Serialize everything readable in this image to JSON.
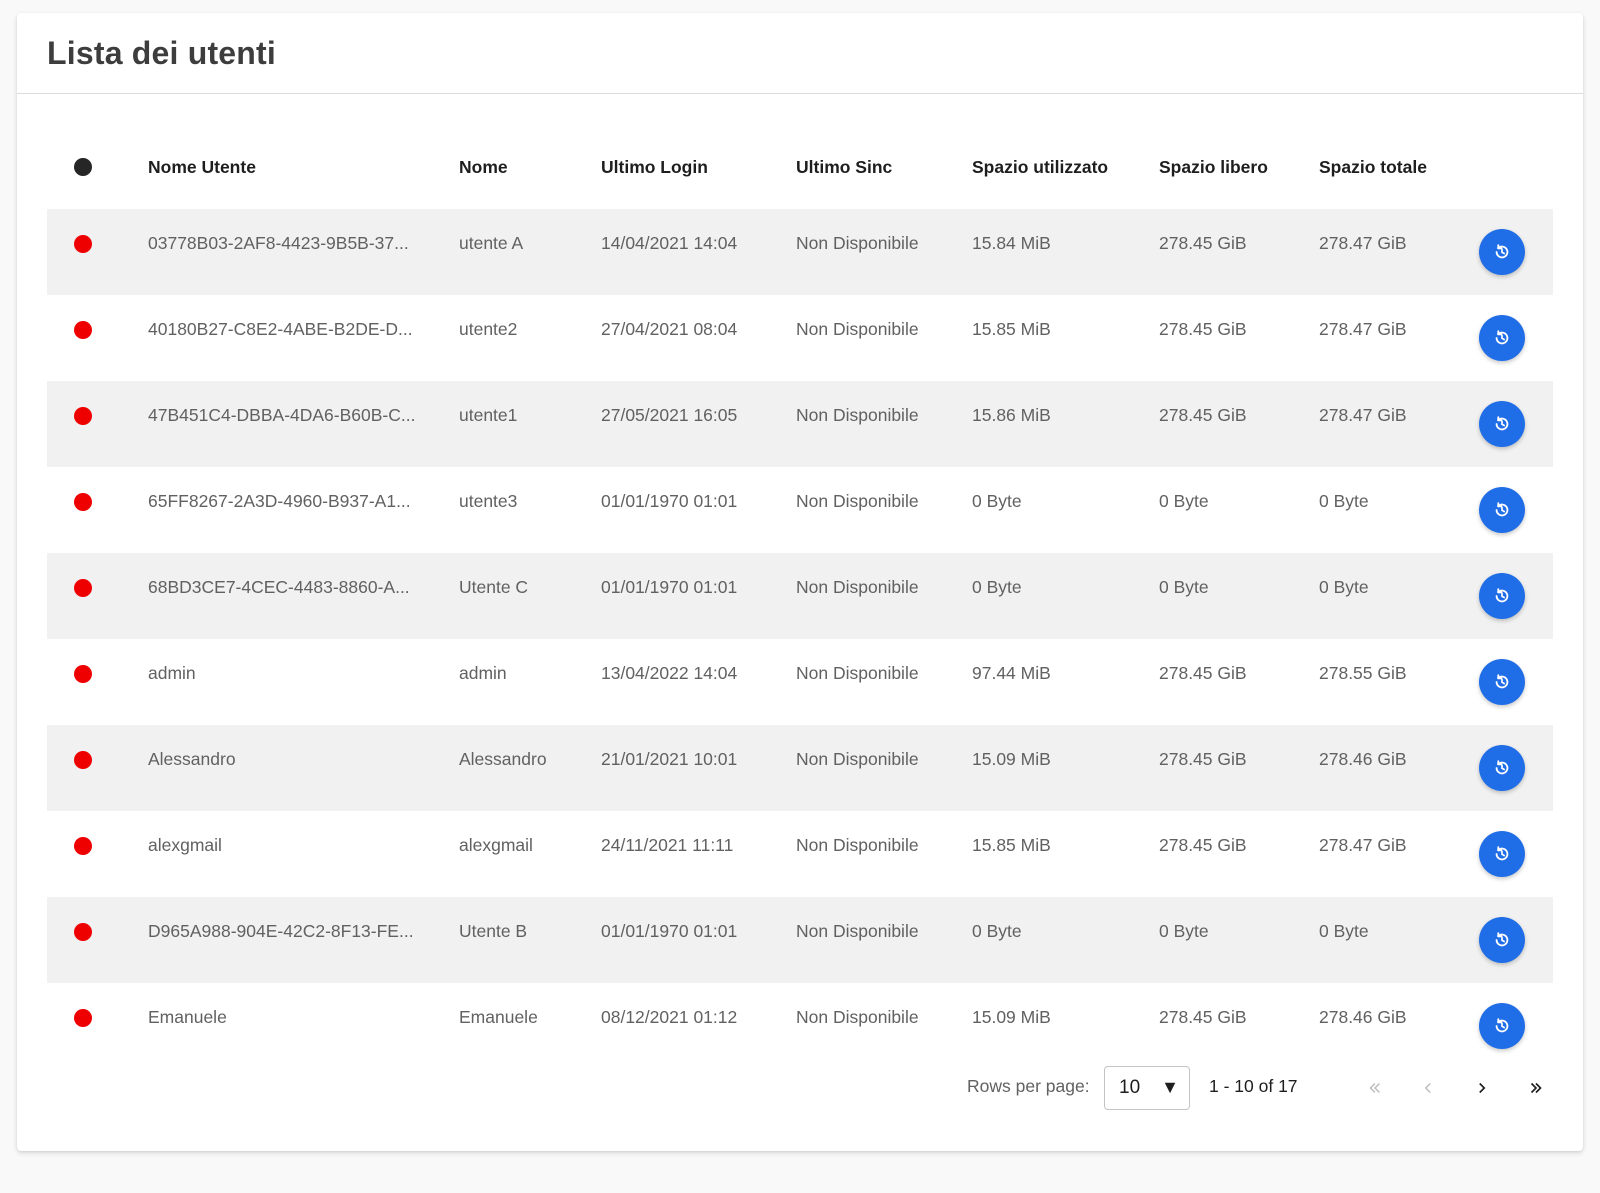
{
  "title": "Lista dei utenti",
  "colors": {
    "accent": "#1f6ee8",
    "status_offline": "#ee0000",
    "status_header": "#262626",
    "row_alt": "#f1f1f1"
  },
  "columns": [
    "Nome Utente",
    "Nome",
    "Ultimo Login",
    "Ultimo Sinc",
    "Spazio utilizzato",
    "Spazio libero",
    "Spazio totale"
  ],
  "rows": [
    {
      "user": "03778B03-2AF8-4423-9B5B-37...",
      "name": "utente A",
      "login": "14/04/2021 14:04",
      "sync": "Non Disponibile",
      "used": "15.84 MiB",
      "free": "278.45 GiB",
      "total": "278.47 GiB"
    },
    {
      "user": "40180B27-C8E2-4ABE-B2DE-D...",
      "name": "utente2",
      "login": "27/04/2021 08:04",
      "sync": "Non Disponibile",
      "used": "15.85 MiB",
      "free": "278.45 GiB",
      "total": "278.47 GiB"
    },
    {
      "user": "47B451C4-DBBA-4DA6-B60B-C...",
      "name": "utente1",
      "login": "27/05/2021 16:05",
      "sync": "Non Disponibile",
      "used": "15.86 MiB",
      "free": "278.45 GiB",
      "total": "278.47 GiB"
    },
    {
      "user": "65FF8267-2A3D-4960-B937-A1...",
      "name": "utente3",
      "login": "01/01/1970 01:01",
      "sync": "Non Disponibile",
      "used": "0 Byte",
      "free": "0 Byte",
      "total": "0 Byte"
    },
    {
      "user": "68BD3CE7-4CEC-4483-8860-A...",
      "name": "Utente C",
      "login": "01/01/1970 01:01",
      "sync": "Non Disponibile",
      "used": "0 Byte",
      "free": "0 Byte",
      "total": "0 Byte"
    },
    {
      "user": "admin",
      "name": "admin",
      "login": "13/04/2022 14:04",
      "sync": "Non Disponibile",
      "used": "97.44 MiB",
      "free": "278.45 GiB",
      "total": "278.55 GiB"
    },
    {
      "user": "Alessandro",
      "name": "Alessandro",
      "login": "21/01/2021 10:01",
      "sync": "Non Disponibile",
      "used": "15.09 MiB",
      "free": "278.45 GiB",
      "total": "278.46 GiB"
    },
    {
      "user": "alexgmail",
      "name": "alexgmail",
      "login": "24/11/2021 11:11",
      "sync": "Non Disponibile",
      "used": "15.85 MiB",
      "free": "278.45 GiB",
      "total": "278.47 GiB"
    },
    {
      "user": "D965A988-904E-42C2-8F13-FE...",
      "name": "Utente B",
      "login": "01/01/1970 01:01",
      "sync": "Non Disponibile",
      "used": "0 Byte",
      "free": "0 Byte",
      "total": "0 Byte"
    },
    {
      "user": "Emanuele",
      "name": "Emanuele",
      "login": "08/12/2021 01:12",
      "sync": "Non Disponibile",
      "used": "15.09 MiB",
      "free": "278.45 GiB",
      "total": "278.46 GiB"
    }
  ],
  "row_action_icon": "history-icon",
  "pagination": {
    "rows_per_page_label": "Rows per page:",
    "rows_per_page_value": "10",
    "range_label": "1 - 10 of 17",
    "icons": [
      "first-page-icon",
      "previous-page-icon",
      "next-page-icon",
      "last-page-icon"
    ]
  }
}
